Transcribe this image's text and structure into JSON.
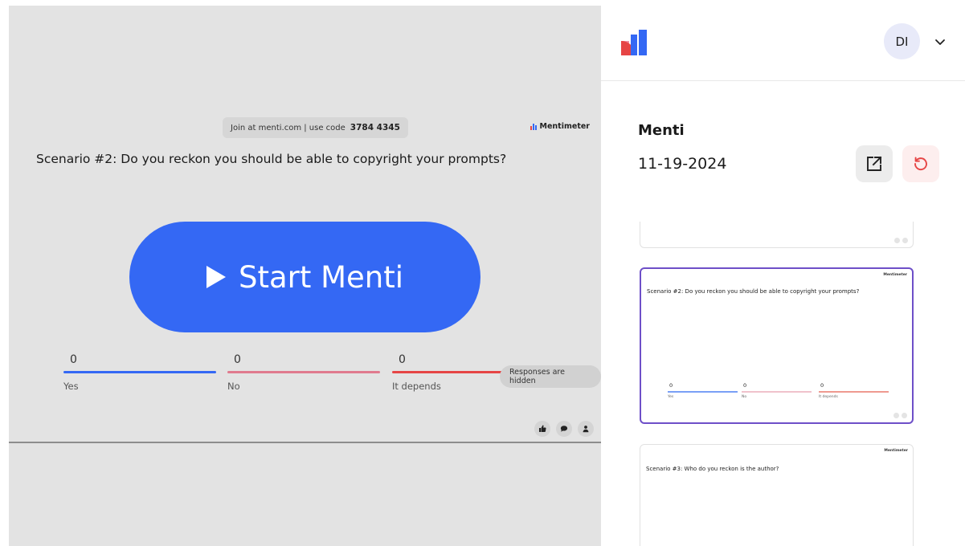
{
  "stage": {
    "join_text": "Join at menti.com | use code",
    "join_code": "3784 4345",
    "brand_name": "Mentimeter",
    "question": "Scenario #2: Do you reckon you should be able to copyright your prompts?",
    "start_button_label": "Start Menti",
    "results": [
      {
        "value": "0",
        "label": "Yes",
        "color": "#3468f4"
      },
      {
        "value": "0",
        "label": "No",
        "color": "#e07a8e"
      },
      {
        "value": "0",
        "label": "It depends",
        "color": "#e64545"
      }
    ],
    "responses_hidden": "Responses are hidden",
    "reaction_icons": [
      "thumbs-up-icon",
      "chat-bubble-icon",
      "person-icon"
    ]
  },
  "panel": {
    "avatar_initials": "DI",
    "title": "Menti",
    "date": "11-19-2024",
    "thumbnails": [
      {
        "question": "Scenario #2: Do you reckon you should be able to copyright your prompts?",
        "brand": "Mentimeter",
        "results": [
          {
            "value": "0",
            "label": "Yes",
            "color": "#7aa0f6"
          },
          {
            "value": "0",
            "label": "No",
            "color": "#f0c2cc"
          },
          {
            "value": "0",
            "label": "It depends",
            "color": "#ef9a90"
          }
        ]
      },
      {
        "question": "Scenario #3: Who do you reckon is the author?",
        "brand": "Mentimeter"
      }
    ]
  },
  "colors": {
    "accent": "#3468f4",
    "active_border": "#6e4fc8",
    "stage_bg": "#e3e3e3"
  }
}
